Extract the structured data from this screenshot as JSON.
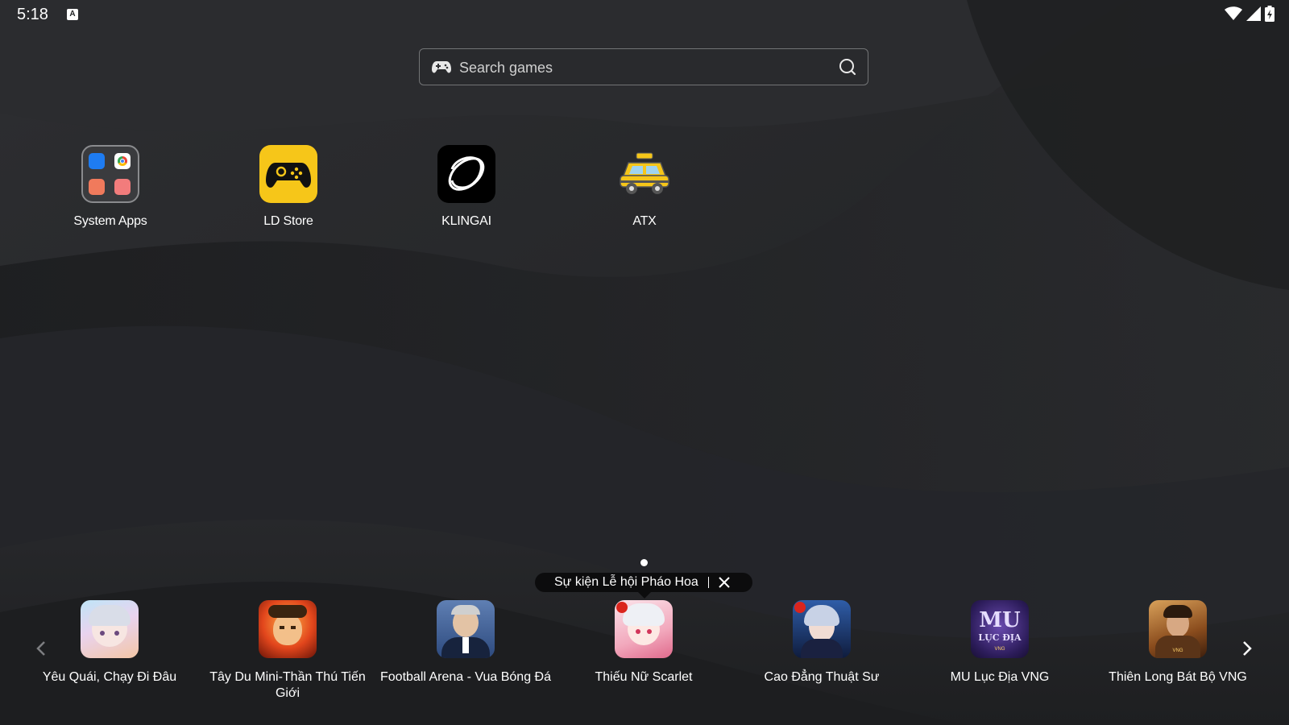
{
  "status_bar": {
    "time": "5:18",
    "keyboard_indicator": "A",
    "icons": [
      "wifi-icon",
      "signal-icon",
      "battery-charging-icon"
    ]
  },
  "search": {
    "placeholder": "Search games",
    "left_icon": "gamepad-icon",
    "right_icon": "search-icon"
  },
  "desktop_apps": [
    {
      "label": "System Apps",
      "icon": "folder-icon"
    },
    {
      "label": "LD Store",
      "icon": "ld-store-icon",
      "color": "#f6c619"
    },
    {
      "label": "KLINGAI",
      "icon": "klingai-icon",
      "color": "#000000"
    },
    {
      "label": "ATX",
      "icon": "taxi-icon",
      "color": "#f6c619"
    }
  ],
  "pager": {
    "current_page": 1,
    "total_pages": 1
  },
  "promo_banner": {
    "text": "Sự kiện Lễ hội Pháo Hoa",
    "close_icon": "close-icon"
  },
  "dock": {
    "prev_icon": "chevron-left-icon",
    "next_icon": "chevron-right-icon",
    "games": [
      {
        "label": "Yêu Quái, Chạy Đi Đâu",
        "icon": "anime-girl-icon"
      },
      {
        "label": "Tây Du Mini-Thần Thú Tiến Giới",
        "icon": "monkey-king-icon"
      },
      {
        "label": "Football Arena - Vua Bóng Đá",
        "icon": "football-coach-icon"
      },
      {
        "label": "Thiếu Nữ Scarlet",
        "icon": "scarlet-girl-icon"
      },
      {
        "label": "Cao Đẳng Thuật Sư",
        "icon": "sorceress-icon"
      },
      {
        "label": "MU Lục Địa VNG",
        "icon": "mu-logo-icon"
      },
      {
        "label": "Thiên Long Bát Bộ VNG",
        "icon": "warrior-icon"
      }
    ]
  },
  "colors": {
    "background": "#232426",
    "wave_light": "#2e2f32",
    "wave_dark": "#1b1c1e",
    "accent_yellow": "#f6c619"
  }
}
